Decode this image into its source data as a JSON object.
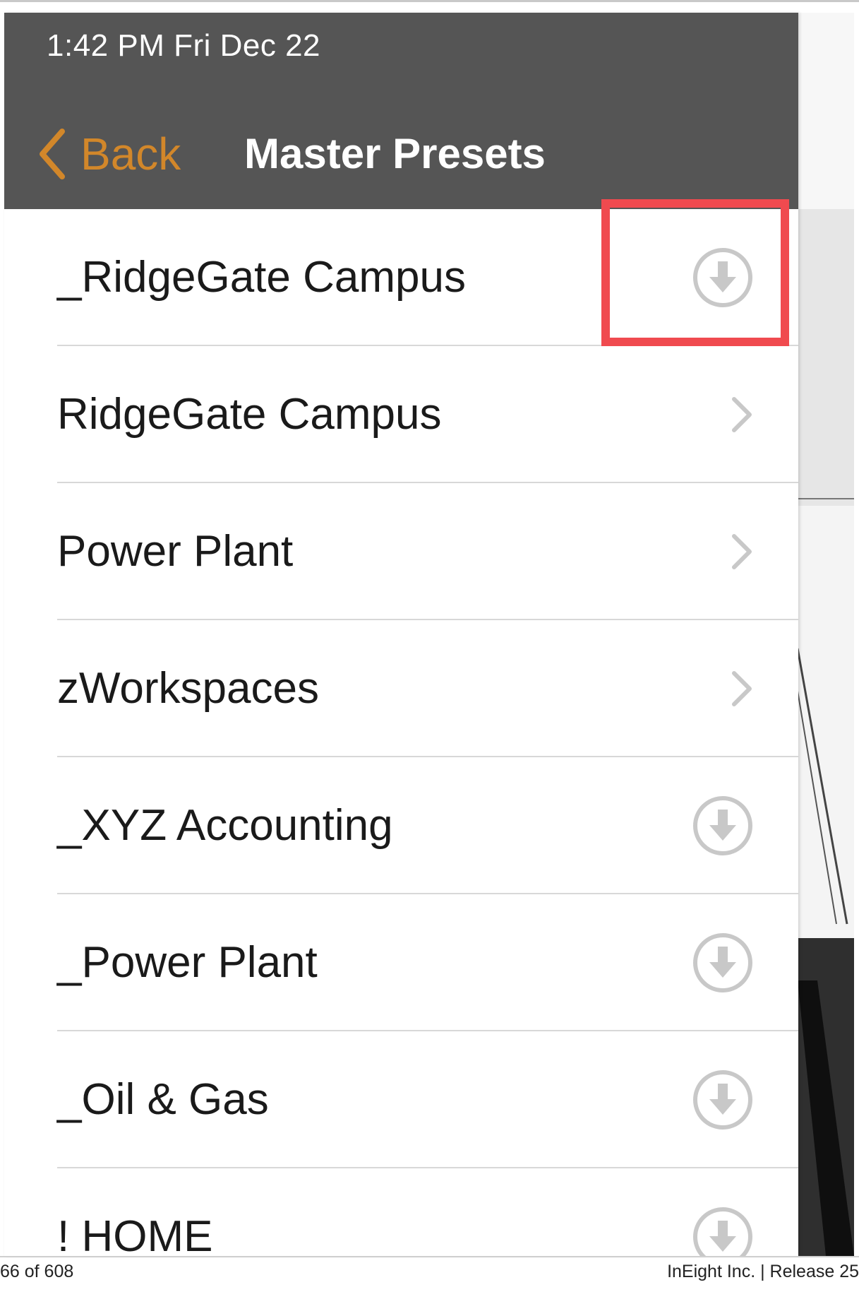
{
  "status_bar": {
    "time": "1:42 PM   Fri Dec 22"
  },
  "nav": {
    "back_label": "Back",
    "title": "Master Presets"
  },
  "list": {
    "items": [
      {
        "label": "_RidgeGate Campus",
        "accessory": "download-icon",
        "highlighted": true
      },
      {
        "label": "RidgeGate Campus",
        "accessory": "chevron-right-icon"
      },
      {
        "label": "Power Plant",
        "accessory": "chevron-right-icon"
      },
      {
        "label": "zWorkspaces",
        "accessory": "chevron-right-icon"
      },
      {
        "label": "_XYZ Accounting",
        "accessory": "download-icon"
      },
      {
        "label": "_Power Plant",
        "accessory": "download-icon"
      },
      {
        "label": "_Oil & Gas",
        "accessory": "download-icon"
      },
      {
        "label": "! HOME",
        "accessory": "download-icon"
      }
    ]
  },
  "footer": {
    "page": "66 of 608",
    "publisher": "InEight Inc. | Release 25"
  },
  "colors": {
    "header_bg": "#555555",
    "accent": "#d2872a",
    "highlight": "#f04a4f",
    "icon_gray": "#c8c8c8"
  }
}
